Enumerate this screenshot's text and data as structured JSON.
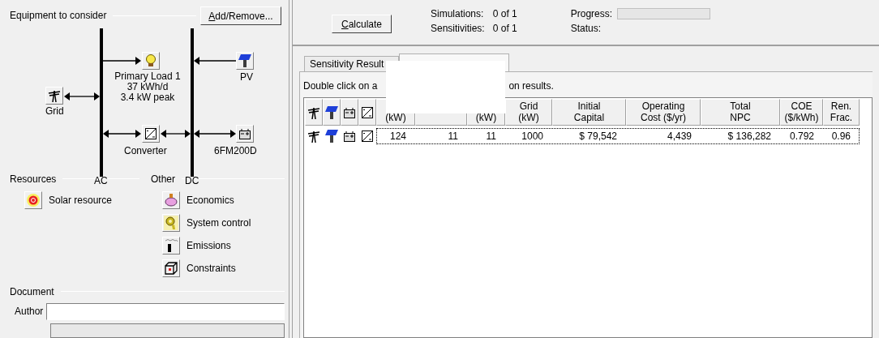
{
  "equipment": {
    "title": "Equipment to consider",
    "button": "Add/Remove...",
    "load": [
      "Primary Load 1",
      "37 kWh/d",
      "3.4 kW peak"
    ],
    "pv": "PV",
    "grid": "Grid",
    "converter": "Converter",
    "battery": "6FM200D",
    "buses": [
      "AC",
      "DC"
    ]
  },
  "resources": {
    "title": "Resources",
    "items": [
      {
        "label": "Solar resource",
        "kind": "sun"
      }
    ]
  },
  "other": {
    "title": "Other",
    "items": [
      {
        "label": "Economics",
        "kind": "piggy"
      },
      {
        "label": "System control",
        "kind": "control"
      },
      {
        "label": "Emissions",
        "kind": "emissions"
      },
      {
        "label": "Constraints",
        "kind": "cube"
      }
    ]
  },
  "document": {
    "title": "Document",
    "author_label": "Author"
  },
  "toolbar": {
    "button": "Calculate",
    "simulations_label": "Simulations:",
    "simulations": "0 of 1",
    "sensitivities_label": "Sensitivities:",
    "sensitivities": "0 of 1",
    "progress_label": "Progress:",
    "status_label": "Status:"
  },
  "tabs": [
    {
      "label": "Sensitivity Result",
      "selected": false
    },
    {
      "selected": true
    }
  ],
  "hint_parts": [
    "Double click on a",
    "on results."
  ],
  "table": {
    "columns": [
      {
        "label": "(kW)"
      },
      {},
      {
        "label": "(kW)"
      },
      {
        "label": "Grid\n(kW)"
      },
      {
        "label": "Initial\nCapital"
      },
      {
        "label": "Operating\nCost ($/yr)"
      },
      {
        "label": "Total\nNPC"
      },
      {
        "label": "COE\n($/kWh)"
      },
      {
        "label": "Ren.\nFrac."
      }
    ],
    "rows": [
      {
        "selected": true,
        "cells": [
          "124",
          "11",
          "11",
          "1000",
          "$ 79,542",
          "4,439",
          "$ 136,282",
          "0.792",
          "0.96"
        ]
      }
    ]
  }
}
